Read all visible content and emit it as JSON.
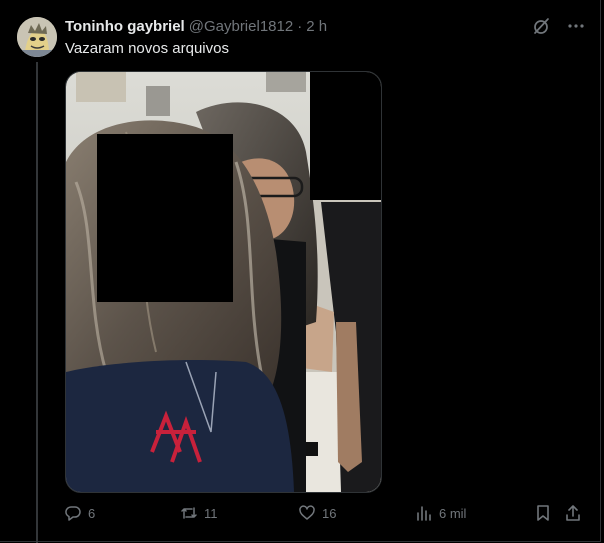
{
  "tweet": {
    "display_name": "Toninho gaybriel",
    "handle": "@Gaybriel1812",
    "separator": "·",
    "time": "2 h",
    "text": "Vazaram novos arquivos"
  },
  "actions": {
    "replies": "6",
    "retweets": "11",
    "likes": "16",
    "views": "6 mil"
  },
  "icons": {
    "top": [
      "grok-icon",
      "more-icon"
    ],
    "actions": [
      "reply-icon",
      "retweet-icon",
      "like-icon",
      "views-icon",
      "bookmark-icon",
      "share-icon"
    ]
  },
  "colors": {
    "background": "#000000",
    "text": "#e7e9ea",
    "muted": "#71767b",
    "border": "#2f3336"
  }
}
